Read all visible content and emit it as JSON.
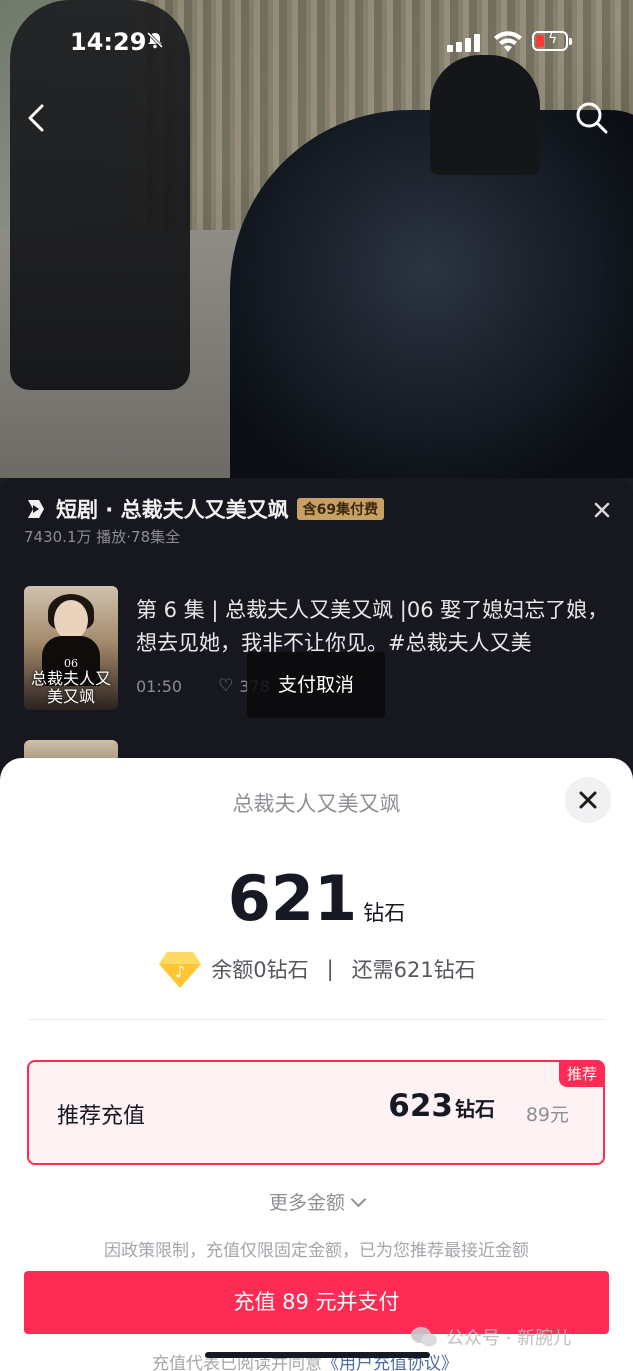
{
  "status_bar": {
    "time": "14:29",
    "icons": [
      "bell-slash-icon",
      "signal-icon",
      "wifi-icon",
      "battery-low-charging-icon"
    ]
  },
  "nav": {
    "back_icon": "chevron-left-icon",
    "search_icon": "search-icon"
  },
  "drama": {
    "title": "短剧 · 总裁夫人又美又飒",
    "badge": "含69集付费",
    "stats": "7430.1万 播放·78集全",
    "episode": {
      "text": "第 6 集 | 总裁夫人又美又飒 |06 娶了媳妇忘了娘，想去见她，我非不让你见。#总裁夫人又美",
      "duration": "01:50",
      "likes": "378",
      "thumb_caption_num": "06",
      "thumb_caption": "总裁夫人又美又飒"
    }
  },
  "toast": "支付取消",
  "payment": {
    "title": "总裁夫人又美又飒",
    "price": "621",
    "price_unit": "钻石",
    "balance": "余额0钻石",
    "separator": "|",
    "needed": "还需621钻石",
    "recommend": {
      "tag": "推荐",
      "label": "推荐充值",
      "amount": "623",
      "amount_unit": "钻石",
      "price": "89元"
    },
    "more": "更多金额",
    "policy": "因政策限制，充值仅限固定金额，已为您推荐最接近金额",
    "pay_button": "充值 89 元并支付",
    "agree_prefix": "充值代表已阅读并同意",
    "agree_link": "《用户充值协议》"
  },
  "watermark": "公众号 · 新腕儿",
  "colors": {
    "accent": "#fe2c55",
    "badge": "#c9a063",
    "panel": "#17181f",
    "link": "#4e6da0"
  }
}
